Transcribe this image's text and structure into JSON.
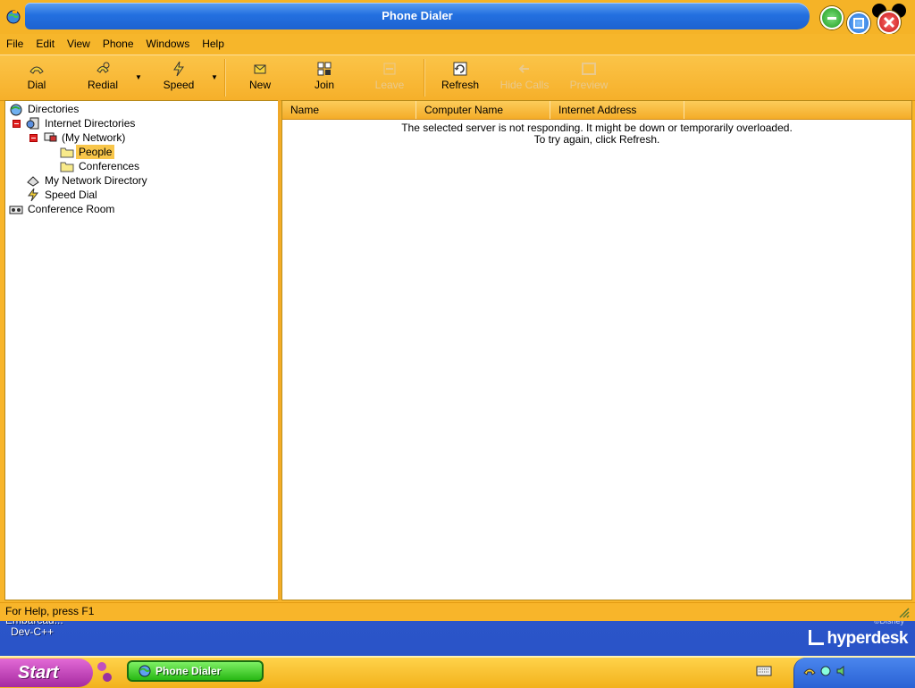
{
  "window": {
    "title": "Phone Dialer"
  },
  "menu": [
    "File",
    "Edit",
    "View",
    "Phone",
    "Windows",
    "Help"
  ],
  "toolbar": {
    "dial": "Dial",
    "redial": "Redial",
    "speed": "Speed",
    "new": "New",
    "join": "Join",
    "leave": "Leave",
    "refresh": "Refresh",
    "hide_calls": "Hide Calls",
    "preview": "Preview"
  },
  "tree": {
    "directories": "Directories",
    "internet_directories": "Internet Directories",
    "my_network": "(My Network)",
    "people": "People",
    "conferences": "Conferences",
    "my_network_directory": "My Network Directory",
    "speed_dial": "Speed Dial",
    "conference_room": "Conference Room"
  },
  "list": {
    "columns": [
      "Name",
      "Computer Name",
      "Internet Address"
    ],
    "message_line1": "The selected server is not responding. It might be down or temporarily overloaded.",
    "message_line2": "To try again, click Refresh."
  },
  "status": {
    "text": "For Help, press F1"
  },
  "desktop": {
    "icon_label_1": "Embarcad...",
    "icon_label_2": "Dev-C++",
    "brand": "hyperdesk",
    "disney": "©Disney"
  },
  "taskbar": {
    "start": "Start",
    "task_phone": "Phone Dialer"
  },
  "colors": {
    "window_bg": "#f8b52a",
    "title_blue": "#2370e0",
    "start": "#b83aae",
    "task_green": "#3ac820"
  }
}
